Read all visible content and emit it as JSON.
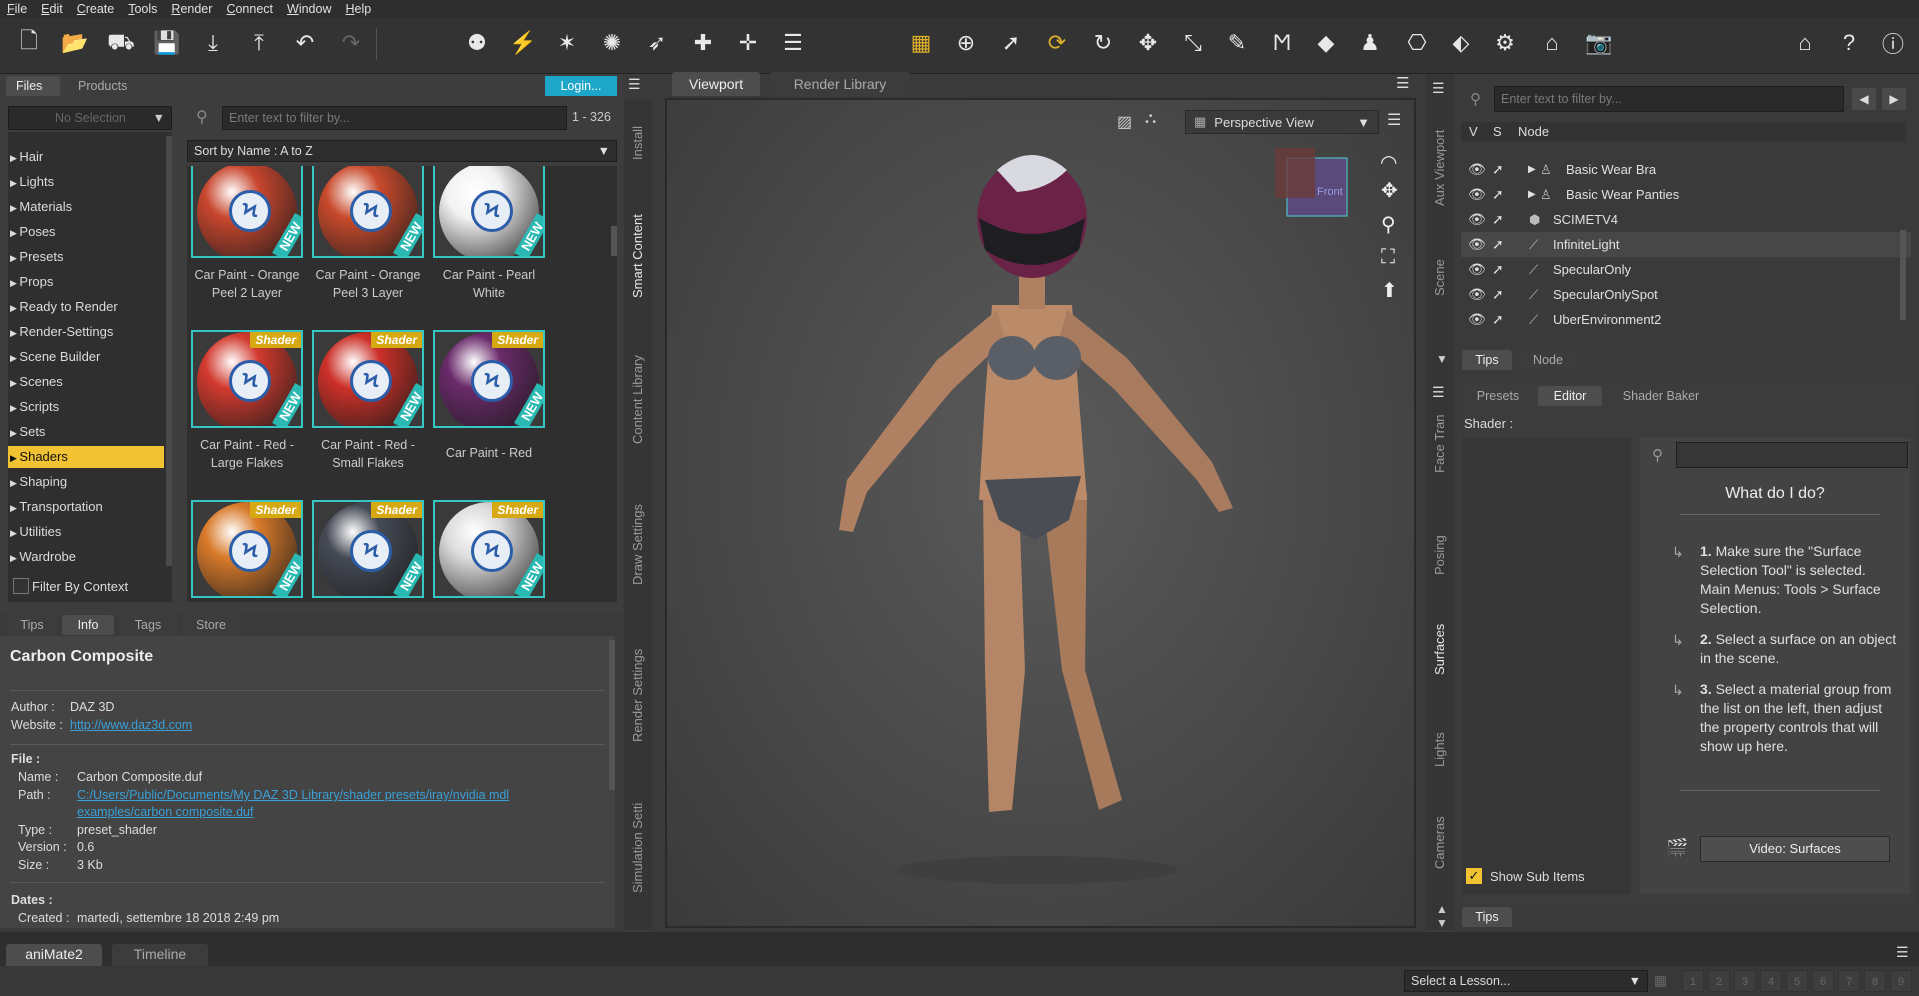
{
  "menu": [
    "File",
    "Edit",
    "Create",
    "Tools",
    "Render",
    "Connect",
    "Window",
    "Help"
  ],
  "left_panel": {
    "tabs": [
      "Files",
      "Products"
    ],
    "login_label": "Login...",
    "selection": "No Selection",
    "filter_placeholder": "Enter text to filter by...",
    "count": "1 - 326",
    "sort": "Sort by Name : A to Z",
    "categories": [
      "Hair",
      "Lights",
      "Materials",
      "Poses",
      "Presets",
      "Props",
      "Ready to Render",
      "Render-Settings",
      "Scene Builder",
      "Scenes",
      "Scripts",
      "Sets",
      "Shaders",
      "Shaping",
      "Transportation",
      "Utilities",
      "Wardrobe"
    ],
    "selected_category": "Shaders",
    "filter_by_context": "Filter By Context",
    "thumbnails": [
      {
        "label1": "Car Paint - Orange",
        "label2": "Peel 2 Layer",
        "badge": "",
        "color": "#c8462e"
      },
      {
        "label1": "Car Paint - Orange",
        "label2": "Peel 3 Layer",
        "badge": "",
        "color": "#c84a2c"
      },
      {
        "label1": "Car Paint - Pearl",
        "label2": "White",
        "badge": "",
        "color": "#f2f2f2"
      },
      {
        "label1": "Car Paint - Red -",
        "label2": "Large Flakes",
        "badge": "Shader",
        "color": "#d23a2e"
      },
      {
        "label1": "Car Paint - Red -",
        "label2": "Small Flakes",
        "badge": "Shader",
        "color": "#cc3028"
      },
      {
        "label1": "Car Paint - Red",
        "label2": "",
        "badge": "Shader",
        "color": "#6a2a6a"
      },
      {
        "label1": "",
        "label2": "",
        "badge": "Shader",
        "color": "#d87a2a"
      },
      {
        "label1": "",
        "label2": "",
        "badge": "Shader",
        "color": "#454a55"
      },
      {
        "label1": "",
        "label2": "",
        "badge": "Shader",
        "color": "#dcdcdc"
      }
    ],
    "new_badge": "NEW"
  },
  "info_panel": {
    "tabs": [
      "Tips",
      "Info",
      "Tags",
      "Store"
    ],
    "active_tab": "Info",
    "title": "Carbon Composite",
    "author_label": "Author :",
    "author": "DAZ 3D",
    "website_label": "Website :",
    "website": "http://www.daz3d.com",
    "file_label": "File :",
    "name_label": "Name :",
    "name": "Carbon Composite.duf",
    "path_label": "Path :",
    "path1": "C:/Users/Public/Documents/My DAZ 3D Library/shader presets/iray/nvidia mdl",
    "path2": "examples/carbon composite.duf",
    "type_label": "Type :",
    "type": "preset_shader",
    "version_label": "Version :",
    "version": "0.6",
    "size_label": "Size :",
    "size": "3 Kb",
    "dates_label": "Dates :",
    "created_label": "Created :",
    "created": "martedì, settembre 18 2018 2:49 pm"
  },
  "side_tabs_left": [
    "Install",
    "Smart Content",
    "Content Library",
    "Draw Settings",
    "Render Settings",
    "Simulation Setti"
  ],
  "viewport": {
    "tabs": [
      "Viewport",
      "Render Library"
    ],
    "view": "Perspective View",
    "cube_label": "Front"
  },
  "scene_panel": {
    "filter_placeholder": "Enter text to filter by...",
    "col_v": "V",
    "col_s": "S",
    "col_node": "Node",
    "nodes": [
      "Basic Wear Bra",
      "Basic Wear Panties",
      "SCIMETV4",
      "InfiniteLight",
      "SpecularOnly",
      "SpecularOnlySpot",
      "UberEnvironment2"
    ],
    "tabs": [
      "Tips",
      "Node"
    ]
  },
  "side_tabs_right": [
    "Aux Viewport",
    "Scene",
    "Face Tran",
    "Posing",
    "Surfaces",
    "Lights",
    "Cameras"
  ],
  "surfaces_panel": {
    "tabs": [
      "Presets",
      "Editor",
      "Shader Baker"
    ],
    "active_tab": "Editor",
    "shader_label": "Shader :",
    "help_title": "What do I do?",
    "steps": [
      {
        "num": "1.",
        "text": "Make sure the \"Surface Selection Tool\" is selected. Main Menus: Tools > Surface Selection."
      },
      {
        "num": "2.",
        "text": "Select a surface on an object in the scene."
      },
      {
        "num": "3.",
        "text": "Select a material group from the list on the left, then adjust the property controls that will show up here."
      }
    ],
    "video_button": "Video: Surfaces",
    "show_sub_items": "Show Sub Items",
    "bottom_tab": "Tips"
  },
  "bottom": {
    "tabs": [
      "aniMate2",
      "Timeline"
    ],
    "lesson_select": "Select a Lesson...",
    "lesson_numbers": [
      "1",
      "2",
      "3",
      "4",
      "5",
      "6",
      "7",
      "8",
      "9"
    ]
  },
  "colors": {
    "accent": "#f1c232",
    "link": "#3aa0d8",
    "thumb_border": "#36c6c4",
    "login": "#1ea6c8"
  }
}
